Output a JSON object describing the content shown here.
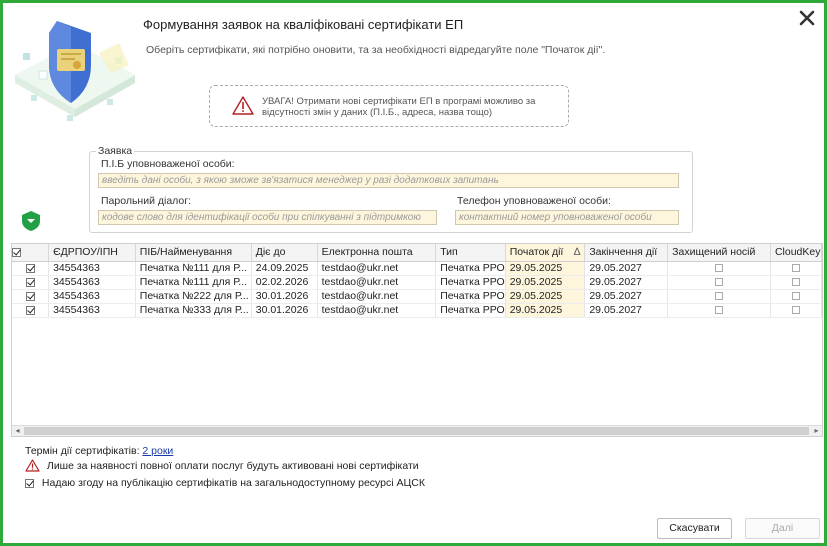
{
  "header": {
    "title": "Формування заявок на кваліфіковані сертифікати ЕП",
    "subtitle": "Оберіть сертифікати, які потрібно оновити, та за необхідності відредагуйте поле \"Початок дії\"."
  },
  "warning": {
    "line1": "УВАГА! Отримати нові сертифікати ЕП в програмі можливо за",
    "line2": "відсутності змін у даних (П.І.Б., адреса, назва тощо)"
  },
  "request": {
    "legend": "Заявка",
    "person_label": "П.І.Б уповноваженої особи:",
    "person_placeholder": "введіть дані особи, з якою зможе зв'язатися менеджер у разі додаткових запитань",
    "password_label": "Парольний діалог:",
    "password_placeholder": "кодове слово для ідентифікації особи при спілкуванні з підтримкою",
    "phone_label": "Телефон уповноваженої особи:",
    "phone_placeholder": "контактний номер уповноваженої особи"
  },
  "table": {
    "columns": [
      "ЄДРПОУ/ІПН",
      "ПІБ/Найменування",
      "Діє до",
      "Електронна пошта",
      "Тип",
      "Початок дії",
      "Закінчення дії",
      "Захищений носій",
      "CloudKey"
    ],
    "sort_indicator": "∆",
    "rows": [
      {
        "checked": true,
        "edrpou": "34554363",
        "name": "Печатка №111 для Р...",
        "valid_to": "24.09.2025",
        "email": "testdao@ukr.net",
        "type": "Печатка РРО",
        "start": "29.05.2025",
        "end": "29.05.2027",
        "secure": false,
        "cloud": false
      },
      {
        "checked": true,
        "edrpou": "34554363",
        "name": "Печатка №111 для Р...",
        "valid_to": "02.02.2026",
        "email": "testdao@ukr.net",
        "type": "Печатка РРО",
        "start": "29.05.2025",
        "end": "29.05.2027",
        "secure": false,
        "cloud": false
      },
      {
        "checked": true,
        "edrpou": "34554363",
        "name": "Печатка №222 для Р...",
        "valid_to": "30.01.2026",
        "email": "testdao@ukr.net",
        "type": "Печатка РРО",
        "start": "29.05.2025",
        "end": "29.05.2027",
        "secure": false,
        "cloud": false
      },
      {
        "checked": true,
        "edrpou": "34554363",
        "name": "Печатка №333 для Р...",
        "valid_to": "30.01.2026",
        "email": "testdao@ukr.net",
        "type": "Печатка РРО",
        "start": "29.05.2025",
        "end": "29.05.2027",
        "secure": false,
        "cloud": false
      }
    ]
  },
  "footer": {
    "term_label": "Термін дії сертифікатів:",
    "term_value": "2 роки",
    "payment_note": "Лише за наявності повної оплати послуг будуть активовані нові сертифікати",
    "consent_label": "Надаю згоду на публікацію сертифікатів на загальнодоступному ресурсі АЦСК",
    "consent_checked": true
  },
  "buttons": {
    "cancel": "Скасувати",
    "next": "Далі"
  },
  "colors": {
    "frame": "#2eaa3a",
    "start_column": "#fdf5dc",
    "link": "#1a3aa8"
  }
}
